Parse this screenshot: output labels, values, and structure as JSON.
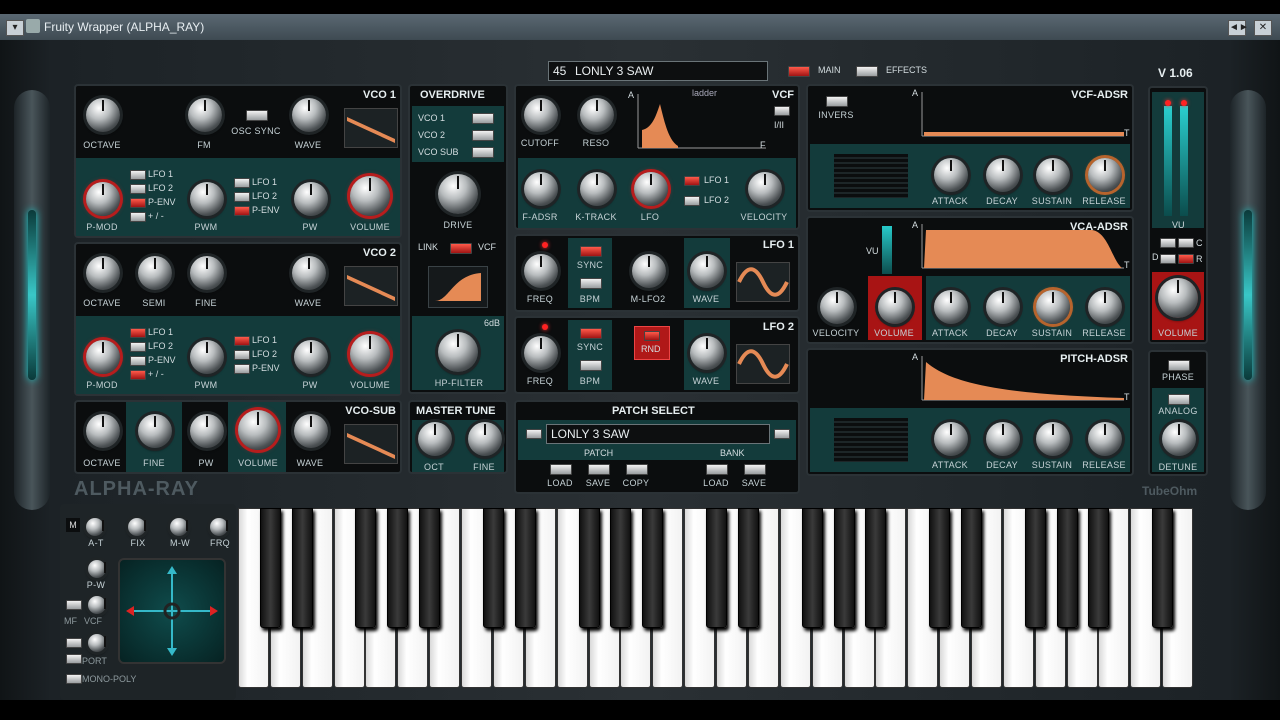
{
  "window": {
    "title": "Fruity Wrapper (ALPHA_RAY)",
    "buttons": [
      "◄►",
      "✕"
    ]
  },
  "header": {
    "patch_number": "45",
    "patch_name": "LONLY 3 SAW",
    "tab_main": "MAIN",
    "tab_effects": "EFFECTS",
    "version": "V 1.06"
  },
  "vco1": {
    "title": "VCO 1",
    "octave": "OCTAVE",
    "fm": "FM",
    "osc_sync": "OSC SYNC",
    "wave": "WAVE",
    "lfo1": "LFO 1",
    "lfo2": "LFO 2",
    "penv": "P-ENV",
    "plusminus": "+ / -",
    "pmod": "P-MOD",
    "pwm": "PWM",
    "pw": "PW",
    "volume": "VOLUME"
  },
  "vco2": {
    "title": "VCO 2",
    "octave": "OCTAVE",
    "semi": "SEMI",
    "fine": "FINE",
    "wave": "WAVE",
    "lfo1": "LFO 1",
    "lfo2": "LFO 2",
    "penv": "P-ENV",
    "plusminus": "+ / -",
    "pmod": "P-MOD",
    "pwm": "PWM",
    "pw": "PW",
    "volume": "VOLUME"
  },
  "vcosub": {
    "title": "VCO-SUB",
    "octave": "OCTAVE",
    "fine": "FINE",
    "pw": "PW",
    "volume": "VOLUME",
    "wave": "WAVE"
  },
  "overdrive": {
    "title": "OVERDRIVE",
    "vco1": "VCO 1",
    "vco2": "VCO 2",
    "vcosub": "VCO SUB",
    "drive": "DRIVE",
    "link": "LINK",
    "vcf": "VCF",
    "db": "6dB",
    "hpfilter": "HP-FILTER"
  },
  "mastertune": {
    "title": "MASTER TUNE",
    "oct": "OCT",
    "fine": "FINE"
  },
  "vcf": {
    "title": "VCF",
    "mode": "I/II",
    "display": "ladder",
    "a": "A",
    "f": "F",
    "cutoff": "CUTOFF",
    "reso": "RESO",
    "fadsr": "F-ADSR",
    "ktrack": "K-TRACK",
    "lfo": "LFO",
    "lfo1": "LFO 1",
    "lfo2": "LFO 2",
    "velocity": "VELOCITY"
  },
  "lfo1": {
    "title": "LFO 1",
    "sync": "SYNC",
    "bpm": "BPM",
    "freq": "FREQ",
    "mlfo2": "M-LFO2",
    "wave": "WAVE"
  },
  "lfo2": {
    "title": "LFO 2",
    "sync": "SYNC",
    "bpm": "BPM",
    "freq": "FREQ",
    "rnd": "RND",
    "wave": "WAVE"
  },
  "patchselect": {
    "title": "PATCH SELECT",
    "name": "LONLY 3 SAW",
    "patch": "PATCH",
    "bank": "BANK",
    "load": "LOAD",
    "save": "SAVE",
    "copy": "COPY",
    "bload": "LOAD",
    "bsave": "SAVE"
  },
  "vcfadsr": {
    "title": "VCF-ADSR",
    "invers": "INVERS",
    "a": "A",
    "t": "T",
    "attack": "ATTACK",
    "decay": "DECAY",
    "sustain": "SUSTAIN",
    "release": "RELEASE"
  },
  "vcaadsr": {
    "title": "VCA-ADSR",
    "vu": "VU",
    "a": "A",
    "t": "T",
    "velocity": "VELOCITY",
    "volume": "VOLUME",
    "attack": "ATTACK",
    "decay": "DECAY",
    "sustain": "SUSTAIN",
    "release": "RELEASE"
  },
  "pitchadsr": {
    "title": "PITCH-ADSR",
    "a": "A",
    "t": "T",
    "attack": "ATTACK",
    "decay": "DECAY",
    "sustain": "SUSTAIN",
    "release": "RELEASE"
  },
  "right": {
    "vu": "VU",
    "c": "C",
    "d": "D",
    "r": "R",
    "volume": "VOLUME",
    "phase": "PHASE",
    "analog": "ANALOG",
    "detune": "DETUNE"
  },
  "brand": {
    "name": "ALPHA-RAY",
    "maker": "TubeOhm"
  },
  "perf": {
    "m": "M",
    "at": "A-T",
    "fix": "FIX",
    "mw": "M-W",
    "frq": "FRQ",
    "pw": "P-W",
    "mf": "MF",
    "vcf": "VCF",
    "port": "PORT",
    "monopoly": "MONO-POLY"
  },
  "colors": {
    "teal": "#133b3b",
    "red": "#d22020",
    "orange": "#e58a55",
    "panel": "#0b0d0e"
  }
}
